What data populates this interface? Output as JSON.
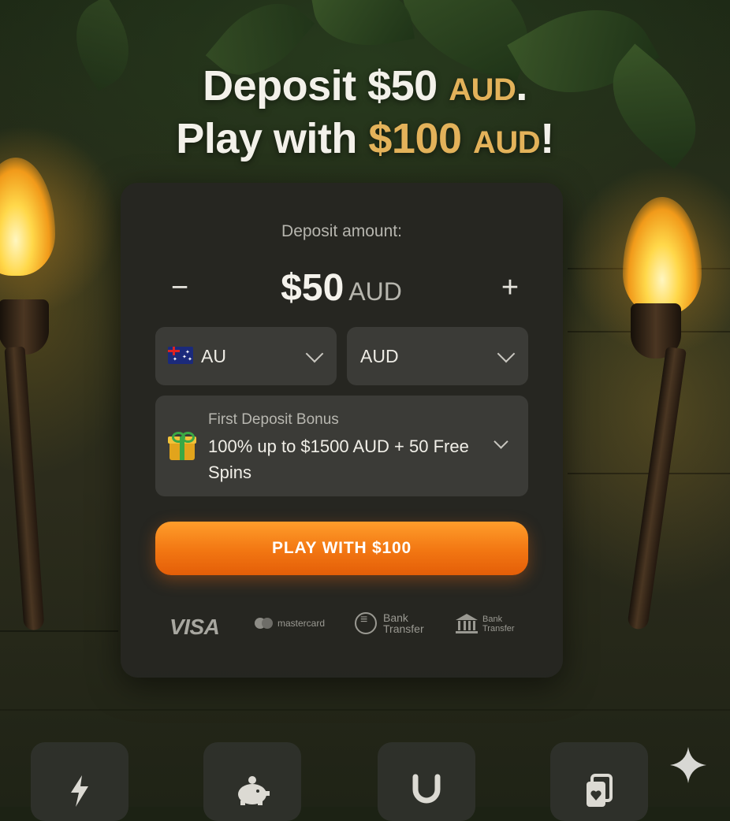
{
  "headline": {
    "line1": {
      "text": "Deposit $50",
      "currency": "AUD",
      "end": "."
    },
    "line2": {
      "text": "Play with",
      "amount": "$100",
      "currency": "AUD",
      "end": "!"
    }
  },
  "card": {
    "amount_label": "Deposit amount:",
    "stepper": {
      "minus": "−",
      "plus": "+",
      "value": "$50",
      "currency": "AUD"
    },
    "country_select": {
      "value": "AU",
      "flag": "australia-flag"
    },
    "currency_select": {
      "value": "AUD"
    },
    "bonus": {
      "title": "First Deposit Bonus",
      "description": "100% up to $1500 AUD + 50 Free Spins",
      "icon": "gift-icon"
    },
    "cta_label": "PLAY WITH $100",
    "payments": {
      "visa": "VISA",
      "mastercard": "mastercard",
      "bank_transfer_1": [
        "Bank",
        "Transfer"
      ],
      "bank_transfer_2": [
        "Bank",
        "Transfer"
      ]
    }
  },
  "bottom_nav": [
    {
      "icon": "lightning-icon"
    },
    {
      "icon": "piggy-bank-icon"
    },
    {
      "icon": "horseshoe-icon"
    },
    {
      "icon": "cards-icon"
    }
  ],
  "colors": {
    "accent_gold": "#e3b25a",
    "cta_orange": "#f27612",
    "card_bg": "#262622",
    "field_bg": "#3b3b37"
  }
}
